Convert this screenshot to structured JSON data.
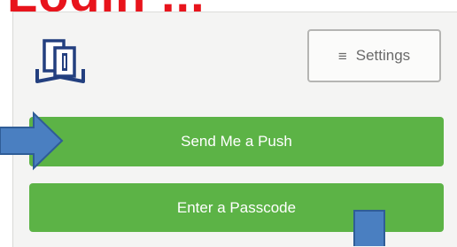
{
  "slide": {
    "heading": "Login ...",
    "heading_color": "#e8141c",
    "arrow_color": "#4a7fc1"
  },
  "app": {
    "logo": "book-logo",
    "settings_label": "Settings",
    "settings_icon": "menu-icon",
    "accent_color": "#5cb346",
    "actions": [
      {
        "label": "Send Me a Push"
      },
      {
        "label": "Enter a Passcode"
      }
    ]
  }
}
